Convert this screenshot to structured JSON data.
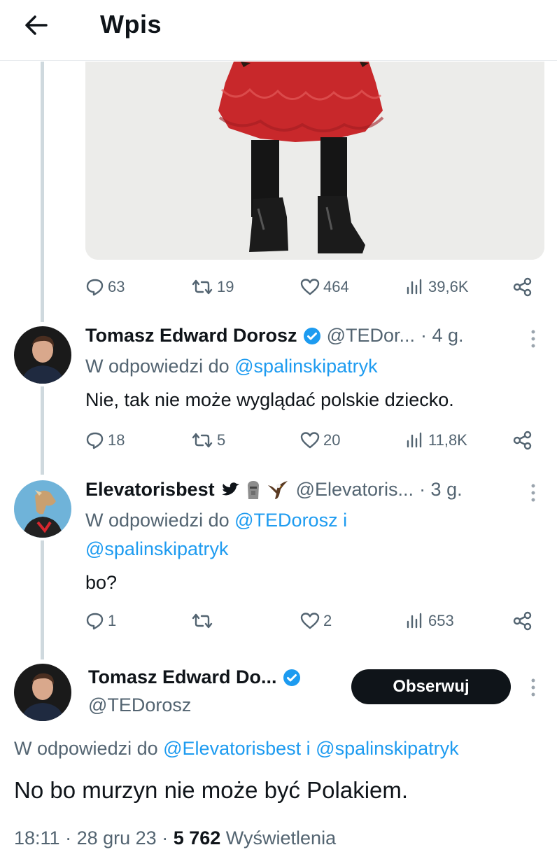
{
  "header": {
    "title": "Wpis"
  },
  "first_post": {
    "replies": "63",
    "reposts": "19",
    "likes": "464",
    "views": "39,6K"
  },
  "reply1": {
    "name": "Tomasz Edward Dorosz",
    "handle": "@TEDor...",
    "time": "· 4 g.",
    "reply_prefix": "W odpowiedzi do",
    "reply_to": "@spalinskipatryk",
    "text": "Nie, tak nie może wyglądać polskie dziecko.",
    "replies": "18",
    "reposts": "5",
    "likes": "20",
    "views": "11,8K"
  },
  "reply2": {
    "name": "Elevatorisbest",
    "handle": "@Elevatoris...",
    "time": "· 3 g.",
    "reply_prefix": "W odpowiedzi do",
    "reply_to_1": "@TEDorosz",
    "reply_join": "i",
    "reply_to_2": "@spalinskipatryk",
    "text": "bo?",
    "replies": "1",
    "likes": "2",
    "views": "653"
  },
  "main": {
    "name": "Tomasz Edward Do...",
    "handle": "@TEDorosz",
    "follow_label": "Obserwuj",
    "reply_prefix": "W odpowiedzi do",
    "reply_to_1": "@Elevatorisbest",
    "reply_join": "i",
    "reply_to_2": "@spalinskipatryk",
    "text": "No bo murzyn nie może być Polakiem.",
    "time": "18:11",
    "date": "28 gru 23",
    "views_count": "5 762",
    "views_label": "Wyświetlenia"
  },
  "colors": {
    "accent": "#1d9bf0",
    "muted": "#536471",
    "text": "#0f1419",
    "verified": "#1d9bf0"
  }
}
